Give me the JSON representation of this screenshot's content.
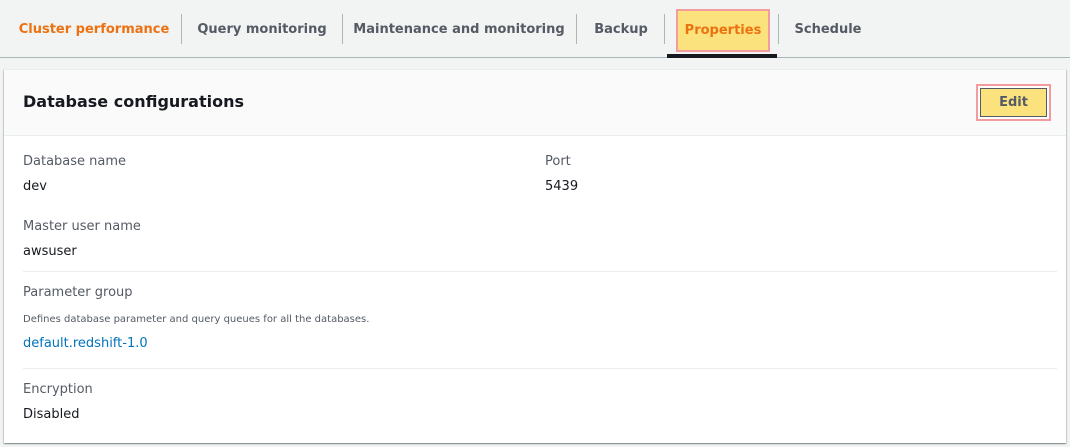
{
  "tabs": [
    {
      "label": "Cluster performance"
    },
    {
      "label": "Query monitoring"
    },
    {
      "label": "Maintenance and monitoring"
    },
    {
      "label": "Backup"
    },
    {
      "label": "Properties"
    },
    {
      "label": "Schedule"
    }
  ],
  "panel": {
    "title": "Database configurations",
    "edit_label": "Edit",
    "database_name": {
      "label": "Database name",
      "value": "dev"
    },
    "port": {
      "label": "Port",
      "value": "5439"
    },
    "master_user": {
      "label": "Master user name",
      "value": "awsuser"
    },
    "parameter_group": {
      "label": "Parameter group",
      "description": "Defines database parameter and query queues for all the databases.",
      "value": "default.redshift-1.0"
    },
    "encryption": {
      "label": "Encryption",
      "value": "Disabled"
    }
  },
  "colors": {
    "accent_orange": "#ec7211",
    "highlight_yellow": "#fbe27c",
    "highlight_border": "#f39ca0",
    "link_blue": "#0073bb"
  }
}
